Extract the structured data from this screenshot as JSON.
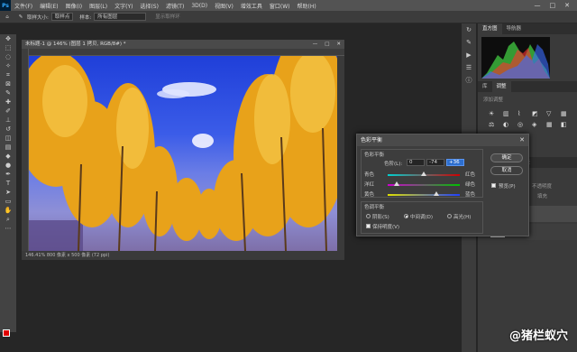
{
  "app": {
    "logo": "Ps"
  },
  "menubar": {
    "items": [
      "文件(F)",
      "编辑(E)",
      "图像(I)",
      "图层(L)",
      "文字(Y)",
      "选择(S)",
      "滤镜(T)",
      "3D(D)",
      "视图(V)",
      "增效工具",
      "窗口(W)",
      "帮助(H)"
    ]
  },
  "window_controls": {
    "minimize": "—",
    "maximize": "□",
    "close": "✕"
  },
  "options": {
    "sample_size_label": "取样大小:",
    "sample_size_value": "取样点",
    "sample_label": "样本:",
    "sample_value": "所有图层",
    "show_ring_label": "显示取样环"
  },
  "document": {
    "tab_title": "未标题-1 @ 146% (图层 1 拷贝, RGB/8#) *",
    "status": "146.41%    800 像素 x 500 像素 (72 ppi)"
  },
  "panels": {
    "tabs": [
      "直方图",
      "导航器"
    ],
    "tabs2": [
      "库",
      "调整"
    ],
    "add_adjustment_label": "添加调整",
    "layer_tabs": [
      "图层",
      "通道",
      "路径"
    ],
    "kind_label": "类型",
    "opacity_label": "不透明度",
    "fill_label": "填充"
  },
  "dialog": {
    "title": "色彩平衡",
    "balance_group": "色彩平衡",
    "levels_label": "色阶(L):",
    "levels": [
      "0",
      "-74",
      "+36"
    ],
    "rows": [
      {
        "left": "青色",
        "right": "红色",
        "value": 0
      },
      {
        "left": "洋红",
        "right": "绿色",
        "value": -74
      },
      {
        "left": "黄色",
        "right": "蓝色",
        "value": 36
      }
    ],
    "tone_group": "色调平衡",
    "tones": [
      "阴影(S)",
      "中间调(D)",
      "高光(H)"
    ],
    "tone_selected": "中间调(D)",
    "preserve_label": "保持明度(V)",
    "ok": "确定",
    "cancel": "取消",
    "preview": "预览(P)"
  },
  "watermark": "@猪栏蚁穴",
  "colors": {
    "foreground": "#e00000",
    "background": "#000000",
    "accent": "#2e6fcf"
  }
}
